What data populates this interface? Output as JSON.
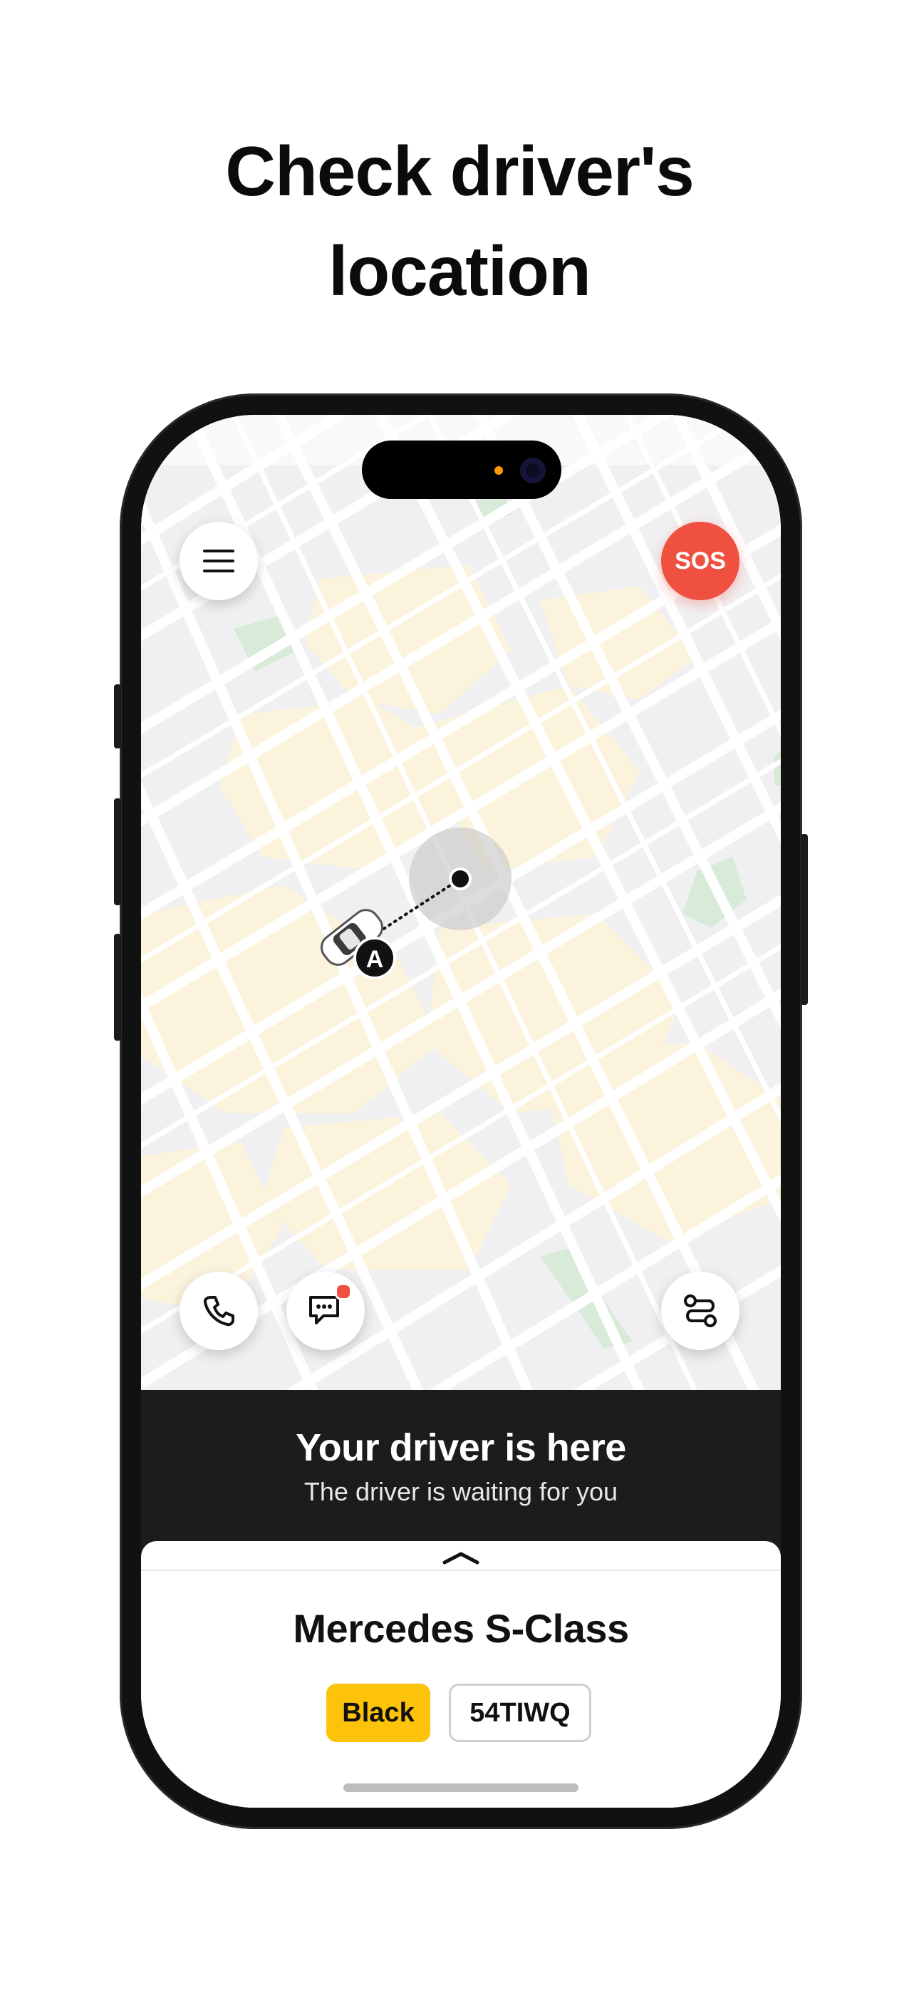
{
  "headline": {
    "line1": "Check driver's",
    "line2": "location"
  },
  "map": {
    "pickup_marker_label": "A"
  },
  "buttons": {
    "menu": "menu",
    "sos_label": "SOS",
    "call": "call",
    "chat": "chat",
    "route": "route"
  },
  "status": {
    "title": "Your driver is here",
    "subtitle": "The driver is waiting for you"
  },
  "vehicle": {
    "model": "Mercedes S-Class",
    "color_label": "Black",
    "plate": "54TIWQ"
  },
  "colors": {
    "sos": "#f0503f",
    "accent_yellow": "#fcc30a",
    "banner": "#1c1c1c"
  }
}
